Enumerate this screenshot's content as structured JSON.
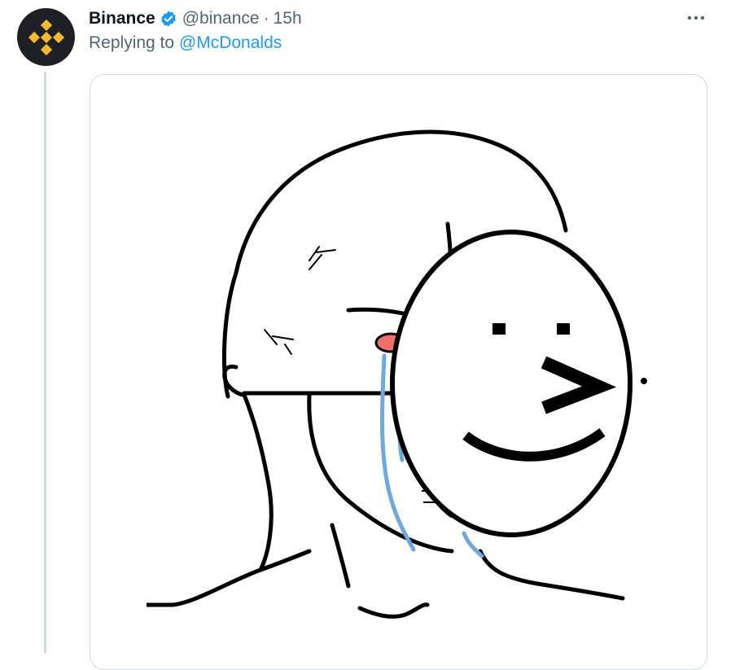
{
  "tweet": {
    "author": {
      "display_name": "Binance",
      "handle": "@binance",
      "verified": true,
      "avatar_icon": "binance-logo-icon",
      "avatar_bg": "#1e2026",
      "logo_color": "#f3ba2f"
    },
    "separator": "·",
    "timestamp": "15h",
    "replying_prefix": "Replying to",
    "replying_to": "@McDonalds",
    "more_icon": "more-horizontal-icon",
    "media": {
      "type": "image",
      "icon": "wojak-mask-meme-image"
    }
  },
  "colors": {
    "link": "#1d9bf0",
    "muted": "#536471",
    "thread_line": "#cfd9de",
    "tears": "#6fa8dc",
    "eye": "#ef6f6f"
  }
}
